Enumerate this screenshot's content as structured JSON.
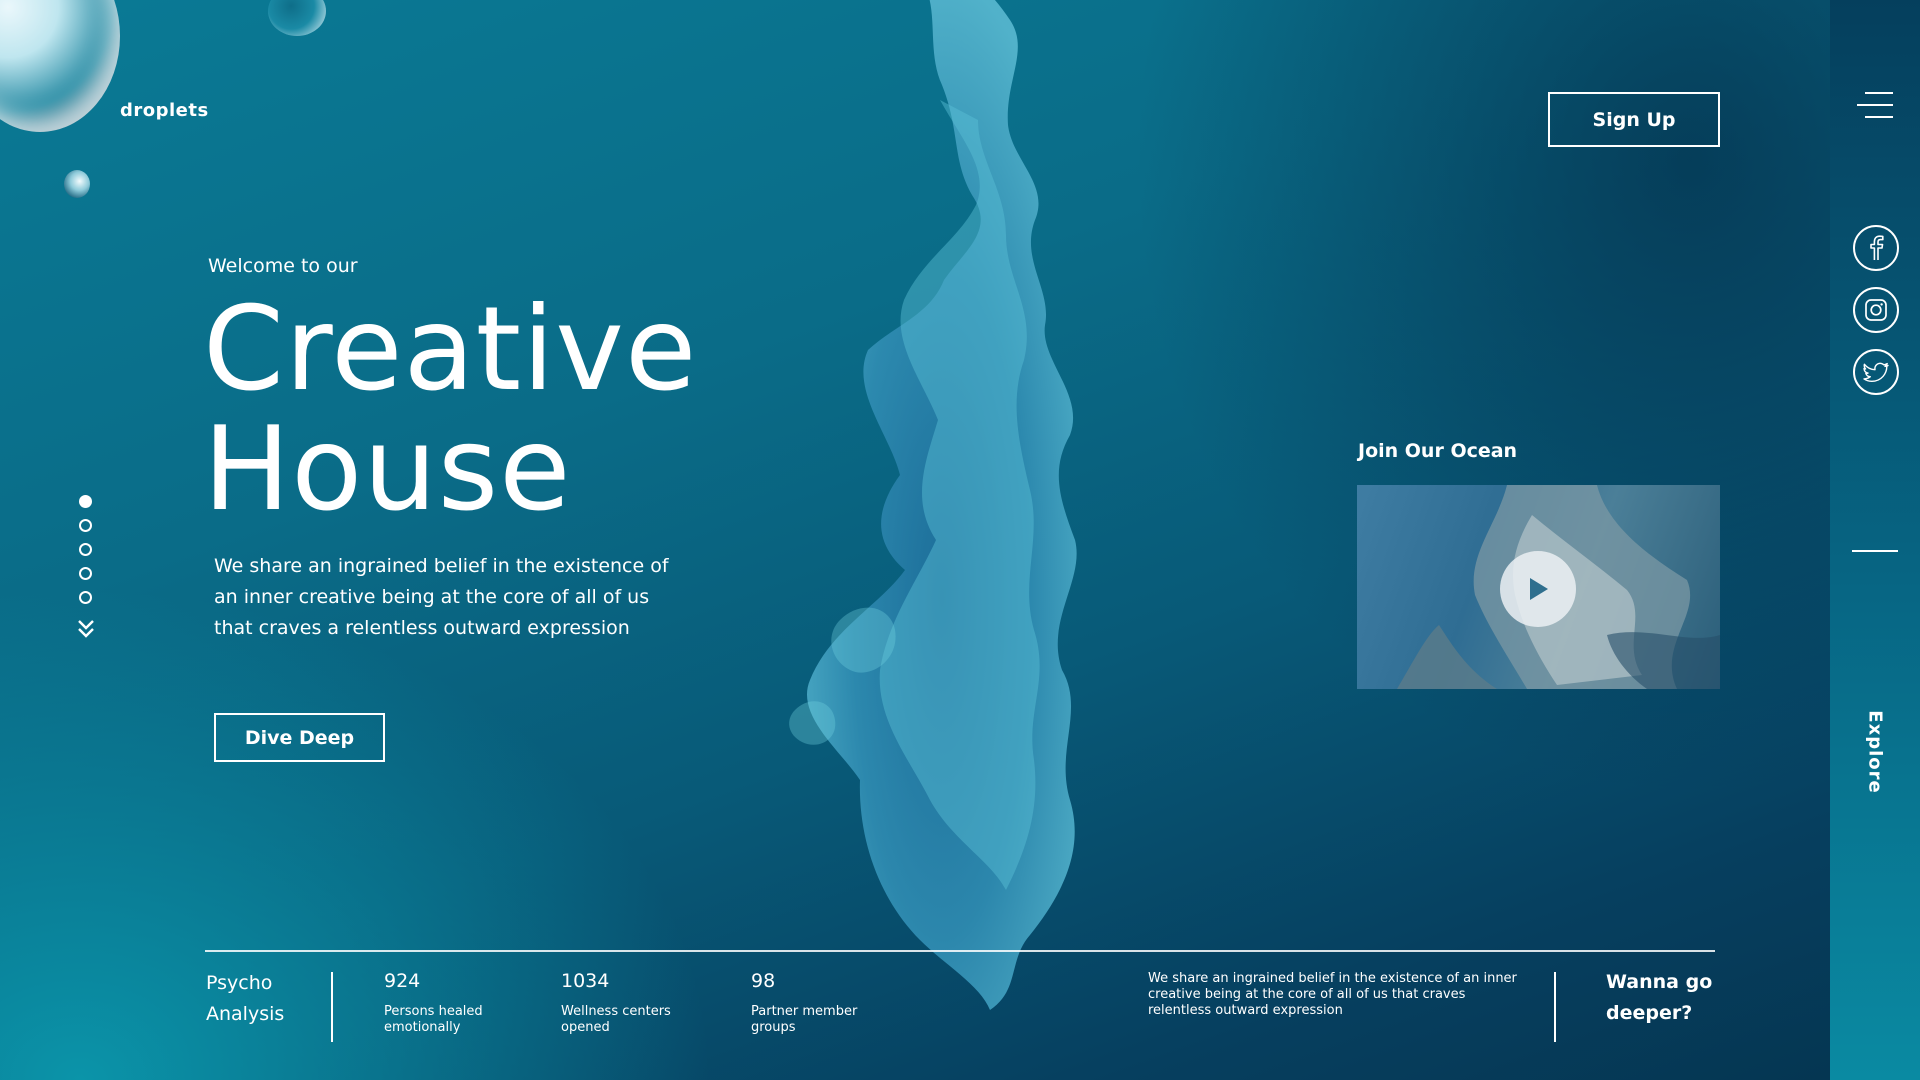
{
  "brand": {
    "name": "droplets"
  },
  "header": {
    "signup_label": "Sign Up"
  },
  "hero": {
    "welcome": "Welcome to our",
    "title_line1": "Creative",
    "title_line2": "House",
    "description": "We share an ingrained belief in the existence of an inner creative being at the core of all of us that craves a relentless outward expression",
    "cta_label": "Dive Deep"
  },
  "slider": {
    "total": 5,
    "active_index": 1
  },
  "video": {
    "heading": "Join Our Ocean"
  },
  "rail": {
    "social_icons": [
      "facebook-icon",
      "instagram-icon",
      "twitter-icon"
    ],
    "explore_label": "Explore"
  },
  "footer": {
    "section_line1": "Psycho",
    "section_line2": "Analysis",
    "stats": [
      {
        "value": "924",
        "label_line1": "Persons healed",
        "label_line2": "emotionally"
      },
      {
        "value": "1034",
        "label_line1": "Wellness centers",
        "label_line2": "opened"
      },
      {
        "value": "98",
        "label_line1": "Partner member",
        "label_line2": "groups"
      }
    ],
    "blurb": "We share an ingrained belief in the existence of an inner creative being at the core of all of us that craves relentless outward expression",
    "cta_line1": "Wanna go",
    "cta_line2": "deeper?"
  },
  "colors": {
    "background": "#0a6c88",
    "rail": "#053f5d",
    "text": "#ffffff",
    "ink": "#2f8cb2"
  }
}
